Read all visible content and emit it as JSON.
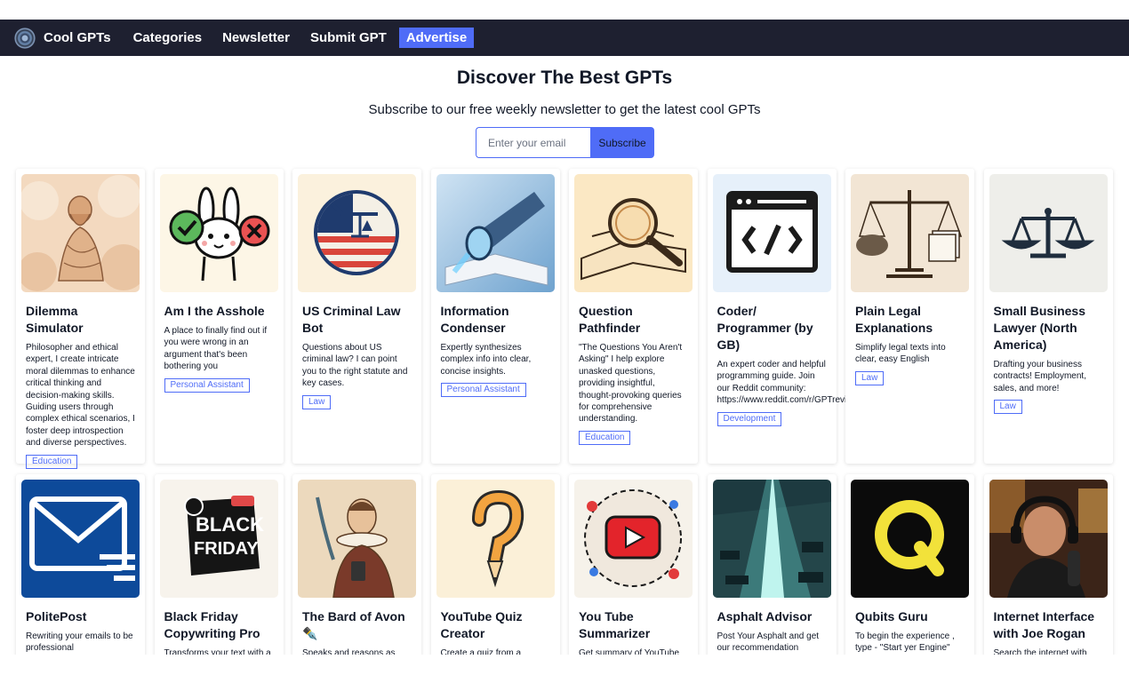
{
  "nav": {
    "brand": "Cool GPTs",
    "links": [
      "Categories",
      "Newsletter",
      "Submit GPT"
    ],
    "advertise": "Advertise"
  },
  "hero": {
    "title": "Discover The Best GPTs",
    "subtitle": "Subscribe to our free weekly newsletter to get the latest cool GPTs",
    "email_placeholder": "Enter your email",
    "subscribe_label": "Subscribe"
  },
  "cards": [
    {
      "title": "Dilemma Simulator",
      "desc": "Philosopher and ethical expert, I create intricate moral dilemmas to enhance critical thinking and decision-making skills. Guiding users through complex ethical scenarios, I foster deep introspection and diverse perspectives.",
      "tag": "Education",
      "icon": "philosopher-statue-image"
    },
    {
      "title": "Am I the Asshole",
      "desc": "A place to finally find out if you were wrong in an argument that's been bothering you",
      "tag": "Personal Assistant",
      "icon": "bunny-check-cross-image"
    },
    {
      "title": "US Criminal Law Bot",
      "desc": "Questions about US criminal law? I can point you to the right statute and key cases.",
      "tag": "Law",
      "icon": "us-flag-scales-image"
    },
    {
      "title": "Information Condenser",
      "desc": "Expertly synthesizes complex info into clear, concise insights.",
      "tag": "Personal Assistant",
      "icon": "lens-book-image"
    },
    {
      "title": "Question Pathfinder",
      "desc": "\"The Questions You Aren't Asking\" I help explore unasked questions, providing insightful, thought-provoking queries for comprehensive understanding.",
      "tag": "Education",
      "icon": "magnifier-book-image"
    },
    {
      "title": "Coder/ Programmer (by GB)",
      "desc": "An expert coder and helpful programming guide. Join our Reddit community: https://www.reddit.com/r/GPTreview/",
      "tag": "Development",
      "icon": "code-window-icon"
    },
    {
      "title": "Plain Legal Explanations",
      "desc": "Simplify legal texts into clear, easy English",
      "tag": "Law",
      "icon": "scale-papers-image"
    },
    {
      "title": "Small Business Lawyer (North America)",
      "desc": "Drafting your business contracts! Employment, sales, and more!",
      "tag": "Law",
      "icon": "scales-icon"
    },
    {
      "title": "PolitePost",
      "desc": "Rewriting your emails to be professional",
      "tag": "",
      "icon": "envelope-icon"
    },
    {
      "title": "Black Friday Copywriting Pro",
      "desc": "Transforms your text with a",
      "tag": "",
      "icon": "black-friday-badge-image"
    },
    {
      "title": "The Bard of Avon ✒️",
      "desc": "Speaks and reasons as",
      "tag": "",
      "icon": "shakespeare-portrait-image"
    },
    {
      "title": "YouTube Quiz Creator",
      "desc": "Create a quiz from a",
      "tag": "",
      "icon": "question-mark-pencil-image"
    },
    {
      "title": "You Tube Summarizer",
      "desc": "Get summary of YouTube",
      "tag": "",
      "icon": "youtube-play-image"
    },
    {
      "title": "Asphalt Advisor",
      "desc": "Post Your Asphalt and get our recommendation",
      "tag": "",
      "icon": "asphalt-road-image"
    },
    {
      "title": "Qubits Guru",
      "desc": "To begin the experience , type - \"Start yer Engine\"",
      "tag": "",
      "icon": "q-letter-image"
    },
    {
      "title": "Internet Interface with Joe Rogan",
      "desc": "Search the internet with",
      "tag": "",
      "icon": "podcast-host-photo"
    }
  ]
}
